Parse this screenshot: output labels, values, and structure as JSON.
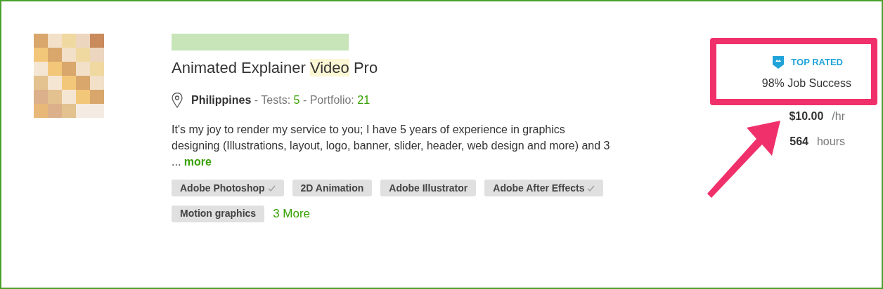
{
  "title": [
    {
      "text": "Animated Explainer ",
      "highlighted": false
    },
    {
      "text": "Video",
      "highlighted": true
    },
    {
      "text": " Pro",
      "highlighted": false
    }
  ],
  "location": {
    "country": "Philippines",
    "tests_label": "- Tests:",
    "tests": "5",
    "portfolio_label": "- Portfolio:",
    "portfolio": "21"
  },
  "description": "It's my joy to render my service to you; I have 5 years of experience in graphics designing (Illustrations, layout, logo, banner, slider, header, web design and more) and 3 ...",
  "more_link": "more",
  "skills": [
    {
      "label": "Adobe Photoshop",
      "verified": true
    },
    {
      "label": "2D Animation",
      "verified": false
    },
    {
      "label": "Adobe Illustrator",
      "verified": false
    },
    {
      "label": "Adobe After Effects",
      "verified": true
    },
    {
      "label": "Motion graphics",
      "verified": false
    }
  ],
  "more_skills": "3 More",
  "badge": {
    "label": "TOP RATED",
    "highlighted": true
  },
  "job_success": "98% Job Success",
  "rate": {
    "amount": "$10.00",
    "unit": "/hr"
  },
  "hours": {
    "amount": "564",
    "unit": "hours"
  }
}
